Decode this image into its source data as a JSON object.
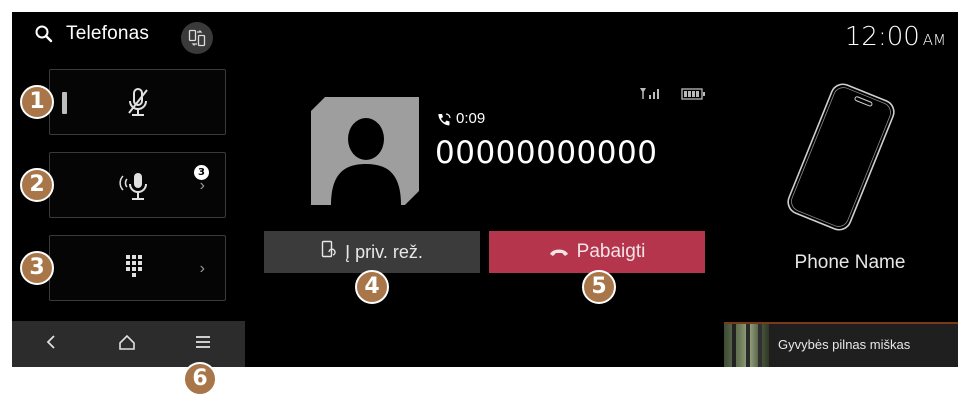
{
  "header": {
    "app_title": "Telefonas",
    "clock_time": "12:00",
    "clock_ampm": "AM"
  },
  "side_buttons": [
    {
      "name": "mute-microphone",
      "icon": "mic-muted-icon",
      "chevron": false
    },
    {
      "name": "voice-recognition",
      "icon": "voice-mic-icon",
      "badge": "3",
      "chevron": true
    },
    {
      "name": "dial-pad",
      "icon": "keypad-icon",
      "chevron": true
    }
  ],
  "markers": [
    "1",
    "2",
    "3",
    "4",
    "5",
    "6"
  ],
  "call": {
    "duration": "0:09",
    "number": "00000000000"
  },
  "buttons": {
    "private_label": "Į priv. rež.",
    "end_label": "Pabaigti"
  },
  "device": {
    "phone_name": "Phone Name"
  },
  "media": {
    "title": "Gyvybės pilnas miškas"
  },
  "colors": {
    "background": "#000000",
    "end_call": "#b5354c",
    "private_button": "#3b3b3b",
    "marker": "#a9764a"
  }
}
